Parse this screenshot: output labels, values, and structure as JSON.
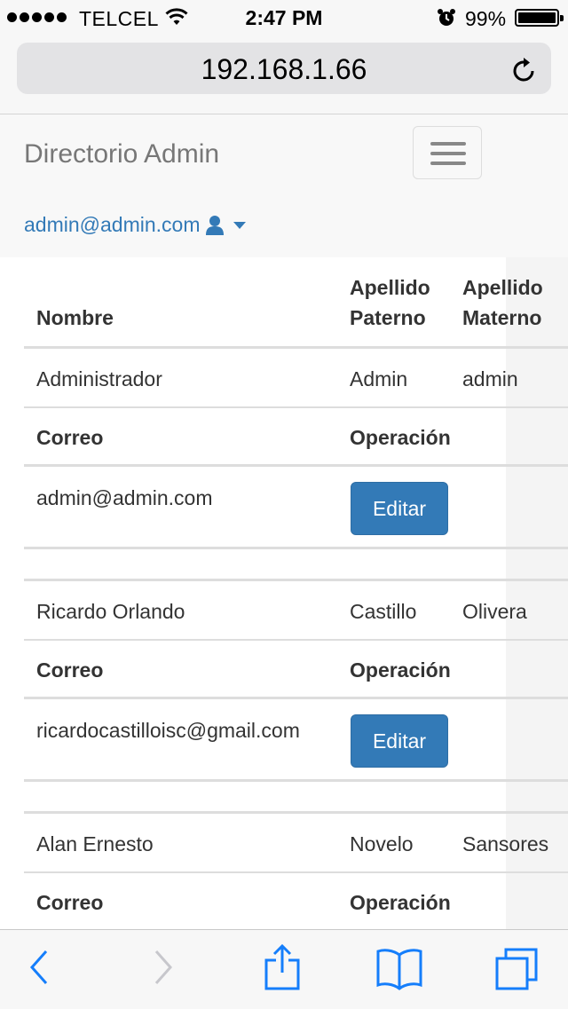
{
  "status_bar": {
    "carrier": "TELCEL",
    "time": "2:47 PM",
    "battery": "99%"
  },
  "browser": {
    "url": "192.168.1.66"
  },
  "navbar": {
    "brand": "Directorio Admin",
    "user_email": "admin@admin.com"
  },
  "table": {
    "headers": {
      "nombre": "Nombre",
      "paterno_1": "Apellido",
      "paterno_2": "Paterno",
      "materno_1": "Apellido",
      "materno_2": "Materno",
      "correo": "Correo",
      "operacion": "Operación"
    },
    "rows": [
      {
        "nombre": "Administrador",
        "paterno": "Admin",
        "materno": "admin",
        "correo": "admin@admin.com",
        "action": "Editar"
      },
      {
        "nombre": "Ricardo Orlando",
        "paterno": "Castillo",
        "materno": "Olivera",
        "correo": "ricardocastilloisc@gmail.com",
        "action": "Editar"
      },
      {
        "nombre": "Alan Ernesto",
        "paterno": "Novelo",
        "materno": "Sansores"
      }
    ]
  },
  "colors": {
    "link": "#337ab7",
    "ios_blue": "#157efb",
    "brand_text": "#777777"
  }
}
